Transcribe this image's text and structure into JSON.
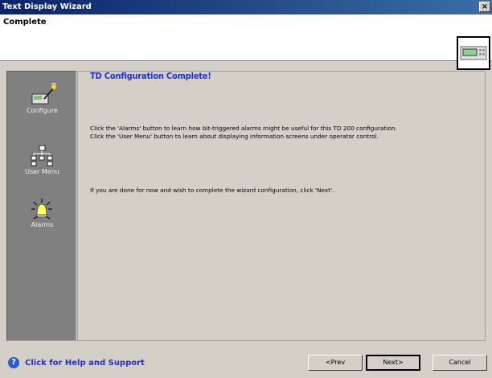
{
  "window": {
    "title": "Text Display Wizard",
    "close_glyph": "×"
  },
  "header": {
    "title": "Complete",
    "device_icon": "td200-device-icon"
  },
  "sidebar": {
    "items": [
      {
        "label": "Configure",
        "icon": "configure-icon"
      },
      {
        "label": "User Menu",
        "icon": "user-menu-icon"
      },
      {
        "label": "Alarms",
        "icon": "alarm-icon"
      }
    ]
  },
  "main": {
    "title": "TD Configuration Complete!",
    "paragraphs": [
      "Click the 'Alarms' button to learn how bit-triggered alarms might be useful for this TD 200 configuration.",
      "Click the 'User Menu' button to learn about displaying information screens under operator control.",
      "If you are done for now and wish to complete the wizard configuration, click 'Next'."
    ]
  },
  "footer": {
    "help_label": "Click for Help and Support",
    "prev_label": "<Prev",
    "next_label": "Next>",
    "cancel_label": "Cancel"
  },
  "colors": {
    "accent": "#1e2fd6",
    "sidebar": "#808080",
    "title_bar": "#0a246a"
  }
}
